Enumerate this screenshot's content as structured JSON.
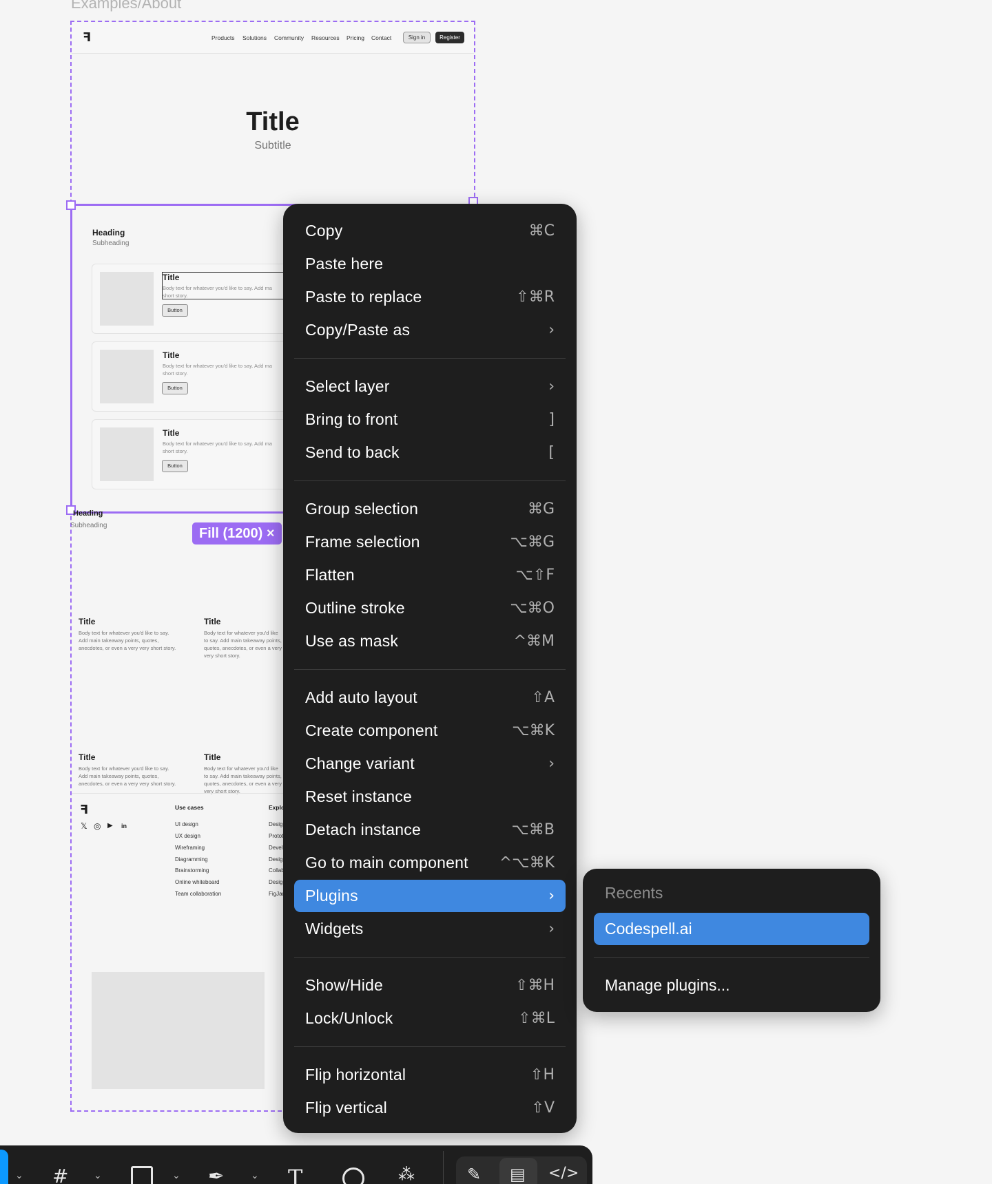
{
  "canvas": {
    "frame_label": "Examples/About",
    "nav": {
      "links": [
        "Products",
        "Solutions",
        "Community",
        "Resources",
        "Pricing",
        "Contact"
      ],
      "sign_in": "Sign in",
      "register": "Register"
    },
    "hero": {
      "title": "Title",
      "subtitle": "Subtitle"
    },
    "section1": {
      "heading": "Heading",
      "subheading": "Subheading",
      "cards": [
        {
          "title": "Title",
          "body": "Body text for whatever you'd like to say. Add ma short story.",
          "button": "Button"
        },
        {
          "title": "Title",
          "body": "Body text for whatever you'd like to say. Add ma short story.",
          "button": "Button"
        },
        {
          "title": "Title",
          "body": "Body text for whatever you'd like to say. Add ma short story.",
          "button": "Button"
        }
      ]
    },
    "fill_badge": "Fill (1200) ×",
    "section2": {
      "heading": "Heading",
      "subheading": "Subheading",
      "items": [
        {
          "title": "Title",
          "body": "Body text for whatever you'd like to say. Add main takeaway points, quotes, anecdotes, or even a very very short story."
        },
        {
          "title": "Title",
          "body": "Body text for whatever you'd like to say. Add main takeaway points, quotes, anecdotes, or even a very very short story."
        },
        {
          "title": "Title",
          "body": "Body text for whatever you'd like to say. Add main takeaway points, quotes, anecdotes, or even a very very short story."
        },
        {
          "title": "Title",
          "body": "Body text for whatever you'd like to say. Add main takeaway points, quotes, anecdotes, or even a very very short story."
        }
      ]
    },
    "footer": {
      "col1": {
        "head": "Use cases",
        "items": [
          "UI design",
          "UX design",
          "Wireframing",
          "Diagramming",
          "Brainstorming",
          "Online whiteboard",
          "Team collaboration"
        ]
      },
      "col2": {
        "head": "Explo",
        "items": [
          "Desig",
          "Protot",
          "Devel",
          "Desig",
          "Collab",
          "Desig",
          "FigJar"
        ]
      },
      "socials": [
        "𝕏",
        "◎",
        "▶",
        "in"
      ]
    }
  },
  "context_menu": {
    "groups": [
      [
        {
          "label": "Copy",
          "shortcut": "⌘C"
        },
        {
          "label": "Paste here",
          "shortcut": ""
        },
        {
          "label": "Paste to replace",
          "shortcut": "⇧⌘R"
        },
        {
          "label": "Copy/Paste as",
          "shortcut": "›"
        }
      ],
      [
        {
          "label": "Select layer",
          "shortcut": "›"
        },
        {
          "label": "Bring to front",
          "shortcut": "]"
        },
        {
          "label": "Send to back",
          "shortcut": "["
        }
      ],
      [
        {
          "label": "Group selection",
          "shortcut": "⌘G"
        },
        {
          "label": "Frame selection",
          "shortcut": "⌥⌘G"
        },
        {
          "label": "Flatten",
          "shortcut": "⌥⇧F"
        },
        {
          "label": "Outline stroke",
          "shortcut": "⌥⌘O"
        },
        {
          "label": "Use as mask",
          "shortcut": "^⌘M"
        }
      ],
      [
        {
          "label": "Add auto layout",
          "shortcut": "⇧A"
        },
        {
          "label": "Create component",
          "shortcut": "⌥⌘K"
        },
        {
          "label": "Change variant",
          "shortcut": "›"
        },
        {
          "label": "Reset instance",
          "shortcut": ""
        },
        {
          "label": "Detach instance",
          "shortcut": "⌥⌘B"
        },
        {
          "label": "Go to main component",
          "shortcut": "^⌥⌘K"
        },
        {
          "label": "Plugins",
          "shortcut": "›"
        },
        {
          "label": "Widgets",
          "shortcut": "›"
        }
      ],
      [
        {
          "label": "Show/Hide",
          "shortcut": "⇧⌘H"
        },
        {
          "label": "Lock/Unlock",
          "shortcut": "⇧⌘L"
        }
      ],
      [
        {
          "label": "Flip horizontal",
          "shortcut": "⇧H"
        },
        {
          "label": "Flip vertical",
          "shortcut": "⇧V"
        }
      ]
    ]
  },
  "plugins_submenu": {
    "heading": "Recents",
    "recent": "Codespell.ai",
    "manage": "Manage plugins..."
  },
  "toolbar": {
    "accent_color": "#0d99ff",
    "icons": [
      "move-icon",
      "frame-icon",
      "rectangle-icon",
      "pen-icon",
      "text-icon",
      "comment-icon",
      "assets-icon",
      "draw-mode-icon",
      "design-mode-icon",
      "dev-mode-icon"
    ]
  }
}
